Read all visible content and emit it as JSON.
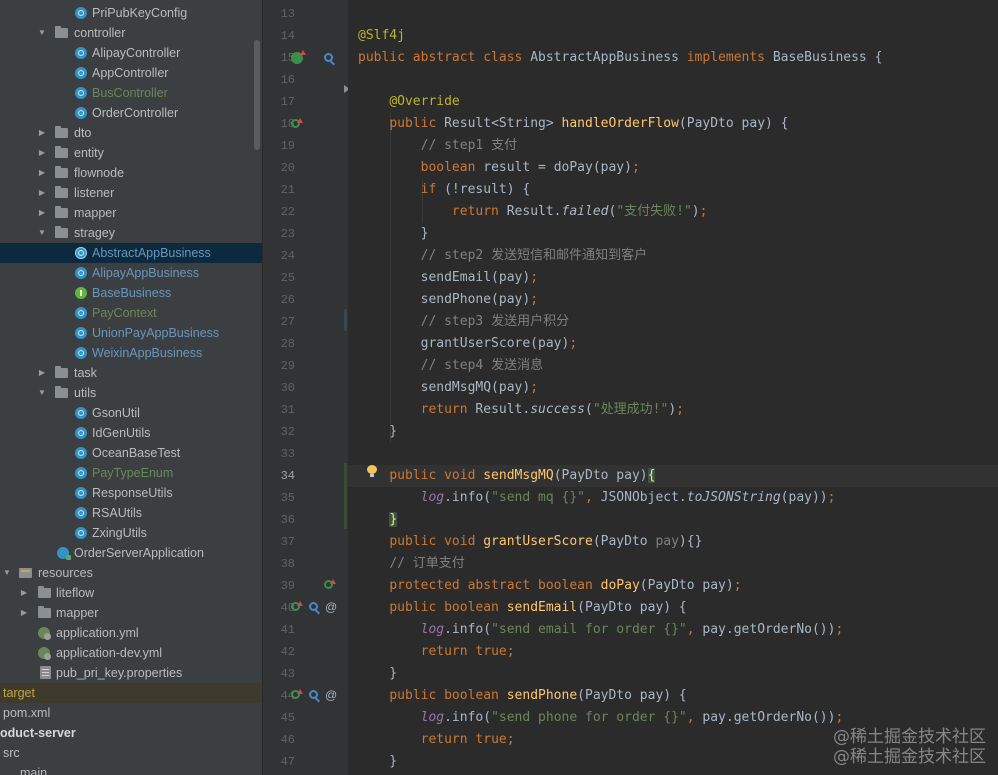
{
  "project_tree": {
    "items": [
      {
        "label": "PriPubKeyConfig",
        "icon": "class-icon"
      },
      {
        "label": "controller",
        "icon": "folder-icon",
        "expanded": true
      },
      {
        "label": "AlipayController",
        "icon": "class-icon"
      },
      {
        "label": "AppController",
        "icon": "class-icon"
      },
      {
        "label": "BusController",
        "icon": "class-icon",
        "color": "#6a8759"
      },
      {
        "label": "OrderController",
        "icon": "class-icon"
      },
      {
        "label": "dto",
        "icon": "folder-icon",
        "expanded": false
      },
      {
        "label": "entity",
        "icon": "folder-icon",
        "expanded": false
      },
      {
        "label": "flownode",
        "icon": "folder-icon",
        "expanded": false
      },
      {
        "label": "listener",
        "icon": "folder-icon",
        "expanded": false
      },
      {
        "label": "mapper",
        "icon": "folder-icon",
        "expanded": false
      },
      {
        "label": "stragey",
        "icon": "folder-icon",
        "expanded": true
      },
      {
        "label": "AbstractAppBusiness",
        "icon": "abstract-class-icon",
        "selected": true,
        "color": "#6897bb"
      },
      {
        "label": "AlipayAppBusiness",
        "icon": "class-icon",
        "color": "#6897bb"
      },
      {
        "label": "BaseBusiness",
        "icon": "interface-icon",
        "color": "#6897bb"
      },
      {
        "label": "PayContext",
        "icon": "class-icon",
        "color": "#6a8759"
      },
      {
        "label": "UnionPayAppBusiness",
        "icon": "class-icon",
        "color": "#6897bb"
      },
      {
        "label": "WeixinAppBusiness",
        "icon": "class-icon",
        "color": "#6897bb"
      },
      {
        "label": "task",
        "icon": "folder-icon",
        "expanded": false
      },
      {
        "label": "utils",
        "icon": "folder-icon",
        "expanded": true
      },
      {
        "label": "GsonUtil",
        "icon": "class-icon"
      },
      {
        "label": "IdGenUtils",
        "icon": "class-icon"
      },
      {
        "label": "OceanBaseTest",
        "icon": "class-icon"
      },
      {
        "label": "PayTypeEnum",
        "icon": "enum-icon",
        "color": "#6a8759"
      },
      {
        "label": "ResponseUtils",
        "icon": "class-icon"
      },
      {
        "label": "RSAUtils",
        "icon": "class-icon"
      },
      {
        "label": "ZxingUtils",
        "icon": "class-icon"
      },
      {
        "label": "OrderServerApplication",
        "icon": "spring-app-icon"
      },
      {
        "label": "resources",
        "icon": "resources-folder-icon",
        "expanded": true
      },
      {
        "label": "liteflow",
        "icon": "folder-icon",
        "expanded": false
      },
      {
        "label": "mapper",
        "icon": "folder-icon",
        "expanded": false
      },
      {
        "label": "application.yml",
        "icon": "yaml-icon"
      },
      {
        "label": "application-dev.yml",
        "icon": "yaml-icon"
      },
      {
        "label": "pub_pri_key.properties",
        "icon": "properties-icon"
      },
      {
        "label": "target",
        "icon": "",
        "color": "#c7a33b"
      },
      {
        "label": "pom.xml",
        "icon": ""
      },
      {
        "label": "oduct-server",
        "icon": "",
        "bold": true
      },
      {
        "label": "src",
        "icon": ""
      },
      {
        "label": "main",
        "icon": ""
      }
    ]
  },
  "editor": {
    "current_line": "34",
    "lines": [
      {
        "n": "13",
        "code": ""
      },
      {
        "n": "14",
        "code": "@Slf4j"
      },
      {
        "n": "15",
        "code": "public abstract class AbstractAppBusiness implements BaseBusiness {"
      },
      {
        "n": "16",
        "code": ""
      },
      {
        "n": "17",
        "code": "    @Override"
      },
      {
        "n": "18",
        "code": "    public Result<String> handleOrderFlow(PayDto pay) {"
      },
      {
        "n": "19",
        "code": "        // step1 支付"
      },
      {
        "n": "20",
        "code": "        boolean result = doPay(pay);"
      },
      {
        "n": "21",
        "code": "        if (!result) {"
      },
      {
        "n": "22",
        "code": "            return Result.failed(\"支付失败!\");"
      },
      {
        "n": "23",
        "code": "        }"
      },
      {
        "n": "24",
        "code": "        // step2 发送短信和邮件通知到客户"
      },
      {
        "n": "25",
        "code": "        sendEmail(pay);"
      },
      {
        "n": "26",
        "code": "        sendPhone(pay);"
      },
      {
        "n": "27",
        "code": "        // step3 发送用户积分"
      },
      {
        "n": "28",
        "code": "        grantUserScore(pay);"
      },
      {
        "n": "29",
        "code": "        // step4 发送消息"
      },
      {
        "n": "30",
        "code": "        sendMsgMQ(pay);"
      },
      {
        "n": "31",
        "code": "        return Result.success(\"处理成功!\");"
      },
      {
        "n": "32",
        "code": "    }"
      },
      {
        "n": "33",
        "code": ""
      },
      {
        "n": "34",
        "code": "    public void sendMsgMQ(PayDto pay){"
      },
      {
        "n": "35",
        "code": "        log.info(\"send mq {}\", JSONObject.toJSONString(pay));"
      },
      {
        "n": "36",
        "code": "    }"
      },
      {
        "n": "37",
        "code": "    public void grantUserScore(PayDto pay){}"
      },
      {
        "n": "38",
        "code": "    // 订单支付"
      },
      {
        "n": "39",
        "code": "    protected abstract boolean doPay(PayDto pay);"
      },
      {
        "n": "40",
        "code": "    public boolean sendEmail(PayDto pay) {"
      },
      {
        "n": "41",
        "code": "        log.info(\"send email for order {}\", pay.getOrderNo());"
      },
      {
        "n": "42",
        "code": "        return true;"
      },
      {
        "n": "43",
        "code": "    }"
      },
      {
        "n": "44",
        "code": "    public boolean sendPhone(PayDto pay) {"
      },
      {
        "n": "45",
        "code": "        log.info(\"send phone for order {}\", pay.getOrderNo());"
      },
      {
        "n": "46",
        "code": "        return true;"
      },
      {
        "n": "47",
        "code": "    }"
      }
    ]
  },
  "watermark": {
    "line1": "@稀土掘金技术社区",
    "line2": "@稀土掘金技术社区"
  },
  "colors": {
    "keyword": "#cc7832",
    "annotation": "#bbb529",
    "method": "#ffc66d",
    "string": "#6a8759",
    "comment": "#808080",
    "text": "#a9b7c6",
    "selection": "#0d293e"
  }
}
